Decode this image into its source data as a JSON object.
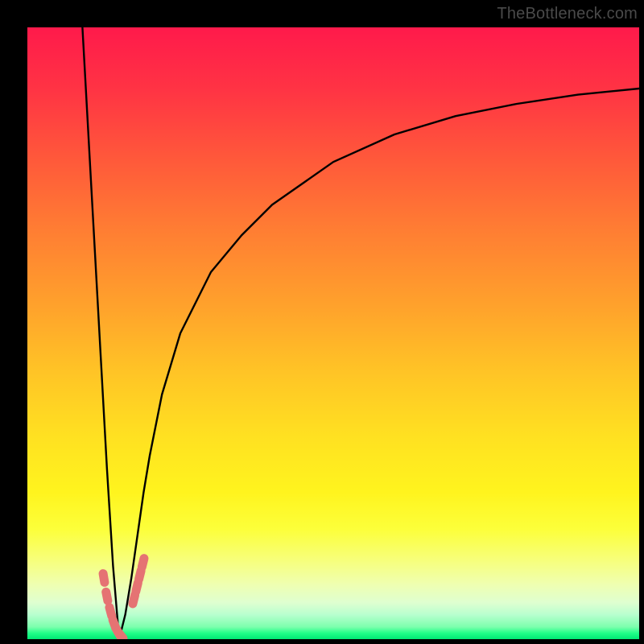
{
  "watermark": "TheBottleneck.com",
  "chart_data": {
    "type": "line",
    "title": "",
    "xlabel": "",
    "ylabel": "",
    "xlim": [
      0,
      100
    ],
    "ylim": [
      0,
      100
    ],
    "grid": false,
    "legend": false,
    "series": [
      {
        "name": "bottleneck-curve",
        "x": [
          9,
          10,
          11,
          12,
          13,
          14,
          15,
          16,
          17,
          18,
          19,
          20,
          22,
          25,
          30,
          35,
          40,
          50,
          60,
          70,
          80,
          90,
          100
        ],
        "y": [
          100,
          82,
          64,
          46,
          28,
          12,
          0,
          4,
          10,
          17,
          24,
          30,
          40,
          50,
          60,
          66,
          71,
          78,
          82.5,
          85.5,
          87.5,
          89,
          90
        ]
      }
    ],
    "markers": [
      {
        "name": "highlight-region-left",
        "points": [
          [
            12.5,
            10
          ],
          [
            13.0,
            7
          ],
          [
            13.6,
            4.5
          ],
          [
            14.2,
            2.5
          ],
          [
            14.8,
            1.2
          ],
          [
            15.2,
            0.7
          ]
        ]
      },
      {
        "name": "highlight-region-right",
        "points": [
          [
            17.4,
            6.5
          ],
          [
            17.9,
            8.5
          ],
          [
            18.4,
            10.5
          ],
          [
            18.9,
            12.5
          ]
        ]
      }
    ],
    "background_gradient": {
      "top": "#ff1a4b",
      "mid": "#ffe121",
      "bottom": "#00e874"
    }
  }
}
